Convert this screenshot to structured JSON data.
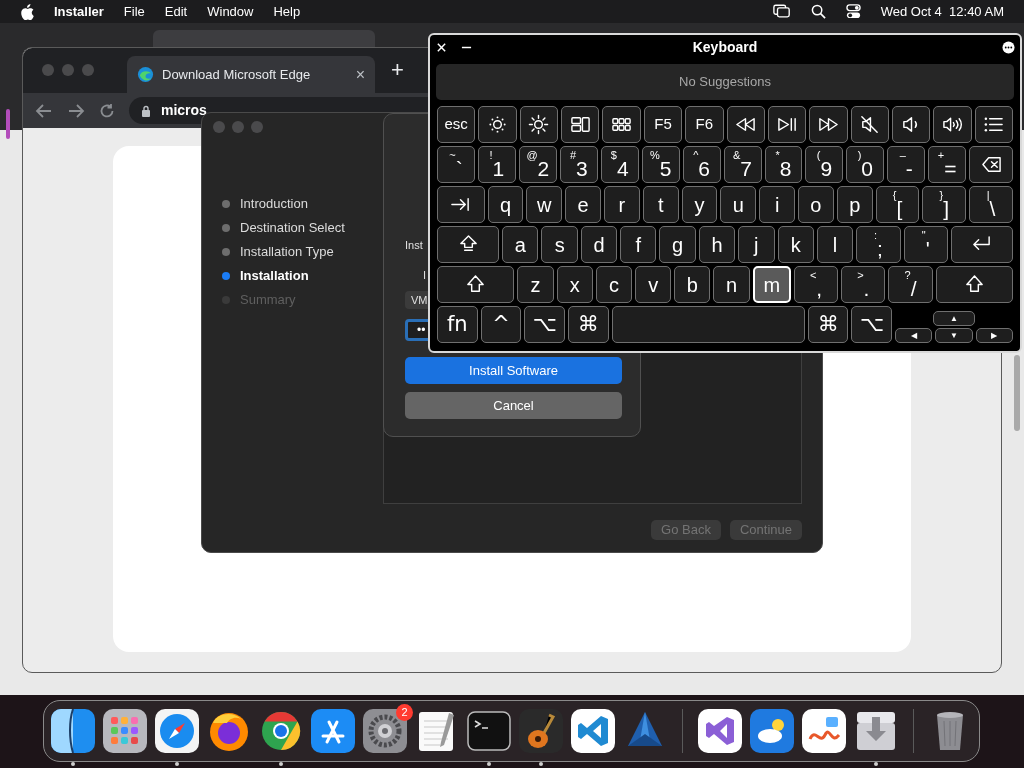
{
  "menu_bar": {
    "app": "Installer",
    "menus": [
      "File",
      "Edit",
      "Window",
      "Help"
    ],
    "clock": "Wed Oct 4  12:40 AM"
  },
  "browser": {
    "tab": {
      "title": "Download Microsoft Edge",
      "close": "×"
    },
    "new_tab": "+",
    "url": {
      "domain": "micros"
    }
  },
  "installer": {
    "steps": [
      {
        "label": "Introduction",
        "selected": false,
        "disabled": false
      },
      {
        "label": "Destination Select",
        "selected": false,
        "disabled": false
      },
      {
        "label": "Installation Type",
        "selected": false,
        "disabled": false
      },
      {
        "label": "Installation",
        "selected": true,
        "disabled": false
      },
      {
        "label": "Summary",
        "selected": false,
        "disabled": true
      }
    ],
    "buttons": [
      {
        "label": "Go Back",
        "disabled": true
      },
      {
        "label": "Continue",
        "disabled": true
      }
    ]
  },
  "auth_sheet": {
    "texts": [
      "Inst",
      "I"
    ],
    "user_field": {
      "value": "VM"
    },
    "password_field": {
      "value": "••",
      "focused": true
    },
    "buttons": [
      {
        "label": "Install Software",
        "default": true
      },
      {
        "label": "Cancel",
        "default": false
      }
    ]
  },
  "keyboard": {
    "title": "Keyboard",
    "suggestions": "No Suggestions",
    "rows": [
      [
        {
          "kind": "text",
          "label": "esc",
          "pressed": false
        },
        {
          "kind": "sun-small",
          "pressed": false
        },
        {
          "kind": "sun-large",
          "pressed": false
        },
        {
          "kind": "windows",
          "pressed": false
        },
        {
          "kind": "grid",
          "pressed": false
        },
        {
          "kind": "text",
          "label": "F5",
          "pressed": false
        },
        {
          "kind": "text",
          "label": "F6",
          "pressed": false
        },
        {
          "kind": "rewind",
          "pressed": false
        },
        {
          "kind": "play-pause",
          "pressed": false
        },
        {
          "kind": "forward",
          "pressed": false
        },
        {
          "kind": "mute",
          "pressed": false
        },
        {
          "kind": "volume-low",
          "pressed": false
        },
        {
          "kind": "volume-high",
          "pressed": false
        },
        {
          "kind": "list",
          "pressed": false
        }
      ],
      [
        {
          "kind": "char",
          "label": "`",
          "shift": "~",
          "pressed": false
        },
        {
          "kind": "char",
          "label": "1",
          "shift": "!",
          "pressed": false
        },
        {
          "kind": "char",
          "label": "2",
          "shift": "@",
          "pressed": false
        },
        {
          "kind": "char",
          "label": "3",
          "shift": "#",
          "pressed": false
        },
        {
          "kind": "char",
          "label": "4",
          "shift": "$",
          "pressed": false
        },
        {
          "kind": "char",
          "label": "5",
          "shift": "%",
          "pressed": false
        },
        {
          "kind": "char",
          "label": "6",
          "shift": "^",
          "pressed": false
        },
        {
          "kind": "char",
          "label": "7",
          "shift": "&",
          "pressed": false
        },
        {
          "kind": "char",
          "label": "8",
          "shift": "*",
          "pressed": false
        },
        {
          "kind": "char",
          "label": "9",
          "shift": "(",
          "pressed": false
        },
        {
          "kind": "char",
          "label": "0",
          "shift": ")",
          "pressed": false
        },
        {
          "kind": "char",
          "label": "-",
          "shift": "–",
          "pressed": false
        },
        {
          "kind": "char",
          "label": "=",
          "shift": "+",
          "pressed": false
        },
        {
          "kind": "delete",
          "pressed": false
        }
      ],
      [
        {
          "kind": "tab",
          "pressed": false
        },
        {
          "kind": "char",
          "label": "q",
          "pressed": false
        },
        {
          "kind": "char",
          "label": "w",
          "pressed": false
        },
        {
          "kind": "char",
          "label": "e",
          "pressed": false
        },
        {
          "kind": "char",
          "label": "r",
          "pressed": false
        },
        {
          "kind": "char",
          "label": "t",
          "pressed": false
        },
        {
          "kind": "char",
          "label": "y",
          "pressed": false
        },
        {
          "kind": "char",
          "label": "u",
          "pressed": false
        },
        {
          "kind": "char",
          "label": "i",
          "pressed": false
        },
        {
          "kind": "char",
          "label": "o",
          "pressed": false
        },
        {
          "kind": "char",
          "label": "p",
          "pressed": false
        },
        {
          "kind": "char",
          "label": "[",
          "shift": "{",
          "pressed": false
        },
        {
          "kind": "char",
          "label": "]",
          "shift": "}",
          "pressed": false
        },
        {
          "kind": "char",
          "label": "\\",
          "shift": "|",
          "pressed": false
        }
      ],
      [
        {
          "kind": "caps",
          "pressed": false
        },
        {
          "kind": "char",
          "label": "a",
          "pressed": false
        },
        {
          "kind": "char",
          "label": "s",
          "pressed": false
        },
        {
          "kind": "char",
          "label": "d",
          "pressed": false
        },
        {
          "kind": "char",
          "label": "f",
          "pressed": false
        },
        {
          "kind": "char",
          "label": "g",
          "pressed": false
        },
        {
          "kind": "char",
          "label": "h",
          "pressed": false
        },
        {
          "kind": "char",
          "label": "j",
          "pressed": false
        },
        {
          "kind": "char",
          "label": "k",
          "pressed": false
        },
        {
          "kind": "char",
          "label": "l",
          "pressed": false
        },
        {
          "kind": "char",
          "label": ";",
          "shift": ":",
          "pressed": false
        },
        {
          "kind": "char",
          "label": "'",
          "shift": "\"",
          "pressed": false
        },
        {
          "kind": "return",
          "pressed": false
        }
      ],
      [
        {
          "kind": "shift",
          "pressed": false
        },
        {
          "kind": "char",
          "label": "z",
          "pressed": false
        },
        {
          "kind": "char",
          "label": "x",
          "pressed": false
        },
        {
          "kind": "char",
          "label": "c",
          "pressed": false
        },
        {
          "kind": "char",
          "label": "v",
          "pressed": false
        },
        {
          "kind": "char",
          "label": "b",
          "pressed": false
        },
        {
          "kind": "char",
          "label": "n",
          "pressed": false
        },
        {
          "kind": "char",
          "label": "m",
          "pressed": true
        },
        {
          "kind": "char",
          "label": ",",
          "shift": "<",
          "pressed": false
        },
        {
          "kind": "char",
          "label": ".",
          "shift": ">",
          "pressed": false
        },
        {
          "kind": "char",
          "label": "/",
          "shift": "?",
          "pressed": false
        },
        {
          "kind": "shift",
          "pressed": false
        }
      ],
      [
        {
          "kind": "mod",
          "label": "fn",
          "pressed": false
        },
        {
          "kind": "mod",
          "label": "^",
          "pressed": false
        },
        {
          "kind": "mod",
          "label": "⌥",
          "pressed": false
        },
        {
          "kind": "mod",
          "label": "⌘",
          "pressed": false
        },
        {
          "kind": "space",
          "pressed": false
        },
        {
          "kind": "mod",
          "label": "⌘",
          "pressed": false
        },
        {
          "kind": "mod",
          "label": "⌥",
          "pressed": false
        }
      ]
    ],
    "arrow_keys": [
      {
        "label": "▲",
        "pressed": false
      },
      {
        "label": "◀",
        "pressed": false
      },
      {
        "label": "▼",
        "pressed": false
      },
      {
        "label": "▶",
        "pressed": false
      }
    ]
  },
  "dock": {
    "items": [
      {
        "kind": "finder",
        "running": true
      },
      {
        "kind": "launchpad",
        "running": false
      },
      {
        "kind": "safari",
        "running": true
      },
      {
        "kind": "firefox",
        "running": false
      },
      {
        "kind": "chrome",
        "running": true
      },
      {
        "kind": "appstore",
        "running": false
      },
      {
        "kind": "settings",
        "running": false,
        "badge": "2"
      },
      {
        "kind": "textedit",
        "running": false
      },
      {
        "kind": "terminal",
        "running": true
      },
      {
        "kind": "guitar",
        "running": true
      },
      {
        "kind": "vscode",
        "running": false
      },
      {
        "kind": "crystal",
        "running": false
      },
      {
        "kind": "separator"
      },
      {
        "kind": "ribbon",
        "running": false
      },
      {
        "kind": "weather",
        "running": false
      },
      {
        "kind": "freeform",
        "running": false
      },
      {
        "kind": "installer",
        "running": true
      },
      {
        "kind": "separator"
      },
      {
        "kind": "trash",
        "running": false
      }
    ]
  }
}
